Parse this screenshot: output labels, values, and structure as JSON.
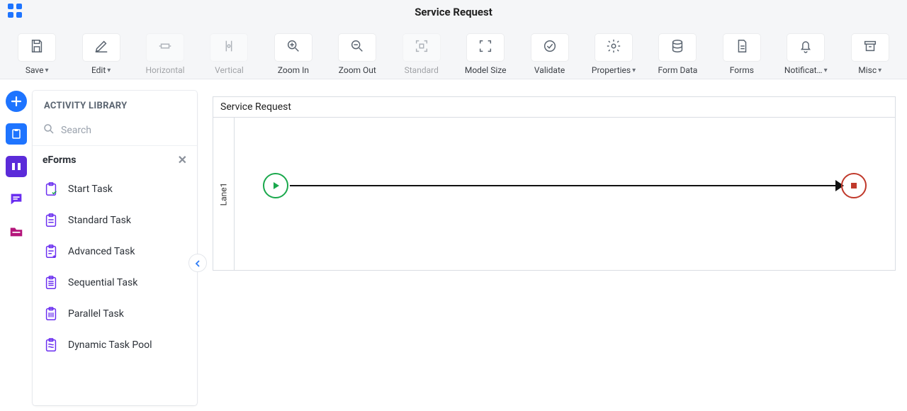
{
  "header": {
    "title": "Service Request"
  },
  "toolbar": [
    {
      "id": "save",
      "label": "Save",
      "dropdown": true,
      "disabled": false
    },
    {
      "id": "edit",
      "label": "Edit",
      "dropdown": true,
      "disabled": false
    },
    {
      "id": "horizontal",
      "label": "Horizontal",
      "dropdown": false,
      "disabled": true
    },
    {
      "id": "vertical",
      "label": "Vertical",
      "dropdown": false,
      "disabled": true
    },
    {
      "id": "zoom-in",
      "label": "Zoom In",
      "dropdown": false,
      "disabled": false
    },
    {
      "id": "zoom-out",
      "label": "Zoom Out",
      "dropdown": false,
      "disabled": false
    },
    {
      "id": "standard",
      "label": "Standard",
      "dropdown": false,
      "disabled": true
    },
    {
      "id": "model-size",
      "label": "Model Size",
      "dropdown": false,
      "disabled": false
    },
    {
      "id": "validate",
      "label": "Validate",
      "dropdown": false,
      "disabled": false
    },
    {
      "id": "properties",
      "label": "Properties",
      "dropdown": true,
      "disabled": false
    },
    {
      "id": "form-data",
      "label": "Form Data",
      "dropdown": false,
      "disabled": false
    },
    {
      "id": "forms",
      "label": "Forms",
      "dropdown": false,
      "disabled": false
    },
    {
      "id": "notifications",
      "label": "Notificat…",
      "dropdown": true,
      "disabled": false
    },
    {
      "id": "misc",
      "label": "Misc",
      "dropdown": true,
      "disabled": false
    }
  ],
  "leftrail": {
    "items": [
      {
        "id": "add",
        "icon": "plus",
        "color": "#1e74ff",
        "shape": "circle"
      },
      {
        "id": "clipboard",
        "icon": "clipboard",
        "color": "#1e74ff",
        "shape": "rounded"
      },
      {
        "id": "lanes",
        "icon": "lanes",
        "color": "#5b2bd9",
        "shape": "rounded"
      },
      {
        "id": "chat",
        "icon": "chat",
        "color": "#6a2ef0",
        "shape": "none"
      },
      {
        "id": "folder",
        "icon": "folder",
        "color": "#b4157a",
        "shape": "none"
      }
    ]
  },
  "sidebar": {
    "title": "ACTIVITY LIBRARY",
    "search_placeholder": "Search",
    "section": "eForms",
    "items": [
      {
        "label": "Start Task"
      },
      {
        "label": "Standard Task"
      },
      {
        "label": "Advanced Task"
      },
      {
        "label": "Sequential Task"
      },
      {
        "label": "Parallel Task"
      },
      {
        "label": "Dynamic Task Pool"
      }
    ]
  },
  "canvas": {
    "process_name": "Service Request",
    "lane_name": "Lane1"
  }
}
